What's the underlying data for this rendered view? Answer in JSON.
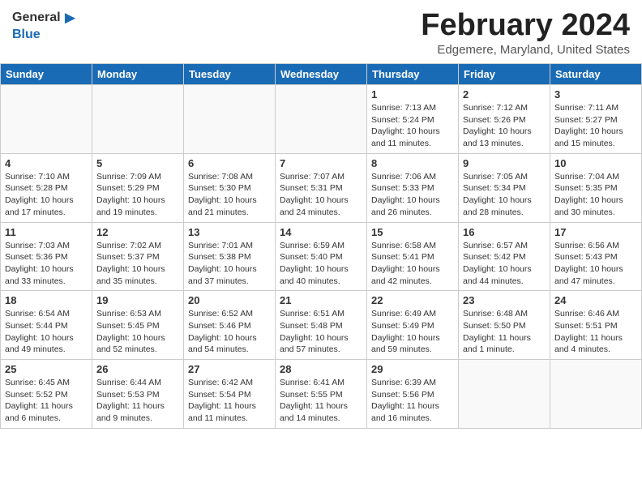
{
  "header": {
    "logo_general": "General",
    "logo_blue": "Blue",
    "month_year": "February 2024",
    "location": "Edgemere, Maryland, United States"
  },
  "days_of_week": [
    "Sunday",
    "Monday",
    "Tuesday",
    "Wednesday",
    "Thursday",
    "Friday",
    "Saturday"
  ],
  "weeks": [
    [
      {
        "day": "",
        "info": ""
      },
      {
        "day": "",
        "info": ""
      },
      {
        "day": "",
        "info": ""
      },
      {
        "day": "",
        "info": ""
      },
      {
        "day": "1",
        "info": "Sunrise: 7:13 AM\nSunset: 5:24 PM\nDaylight: 10 hours\nand 11 minutes."
      },
      {
        "day": "2",
        "info": "Sunrise: 7:12 AM\nSunset: 5:26 PM\nDaylight: 10 hours\nand 13 minutes."
      },
      {
        "day": "3",
        "info": "Sunrise: 7:11 AM\nSunset: 5:27 PM\nDaylight: 10 hours\nand 15 minutes."
      }
    ],
    [
      {
        "day": "4",
        "info": "Sunrise: 7:10 AM\nSunset: 5:28 PM\nDaylight: 10 hours\nand 17 minutes."
      },
      {
        "day": "5",
        "info": "Sunrise: 7:09 AM\nSunset: 5:29 PM\nDaylight: 10 hours\nand 19 minutes."
      },
      {
        "day": "6",
        "info": "Sunrise: 7:08 AM\nSunset: 5:30 PM\nDaylight: 10 hours\nand 21 minutes."
      },
      {
        "day": "7",
        "info": "Sunrise: 7:07 AM\nSunset: 5:31 PM\nDaylight: 10 hours\nand 24 minutes."
      },
      {
        "day": "8",
        "info": "Sunrise: 7:06 AM\nSunset: 5:33 PM\nDaylight: 10 hours\nand 26 minutes."
      },
      {
        "day": "9",
        "info": "Sunrise: 7:05 AM\nSunset: 5:34 PM\nDaylight: 10 hours\nand 28 minutes."
      },
      {
        "day": "10",
        "info": "Sunrise: 7:04 AM\nSunset: 5:35 PM\nDaylight: 10 hours\nand 30 minutes."
      }
    ],
    [
      {
        "day": "11",
        "info": "Sunrise: 7:03 AM\nSunset: 5:36 PM\nDaylight: 10 hours\nand 33 minutes."
      },
      {
        "day": "12",
        "info": "Sunrise: 7:02 AM\nSunset: 5:37 PM\nDaylight: 10 hours\nand 35 minutes."
      },
      {
        "day": "13",
        "info": "Sunrise: 7:01 AM\nSunset: 5:38 PM\nDaylight: 10 hours\nand 37 minutes."
      },
      {
        "day": "14",
        "info": "Sunrise: 6:59 AM\nSunset: 5:40 PM\nDaylight: 10 hours\nand 40 minutes."
      },
      {
        "day": "15",
        "info": "Sunrise: 6:58 AM\nSunset: 5:41 PM\nDaylight: 10 hours\nand 42 minutes."
      },
      {
        "day": "16",
        "info": "Sunrise: 6:57 AM\nSunset: 5:42 PM\nDaylight: 10 hours\nand 44 minutes."
      },
      {
        "day": "17",
        "info": "Sunrise: 6:56 AM\nSunset: 5:43 PM\nDaylight: 10 hours\nand 47 minutes."
      }
    ],
    [
      {
        "day": "18",
        "info": "Sunrise: 6:54 AM\nSunset: 5:44 PM\nDaylight: 10 hours\nand 49 minutes."
      },
      {
        "day": "19",
        "info": "Sunrise: 6:53 AM\nSunset: 5:45 PM\nDaylight: 10 hours\nand 52 minutes."
      },
      {
        "day": "20",
        "info": "Sunrise: 6:52 AM\nSunset: 5:46 PM\nDaylight: 10 hours\nand 54 minutes."
      },
      {
        "day": "21",
        "info": "Sunrise: 6:51 AM\nSunset: 5:48 PM\nDaylight: 10 hours\nand 57 minutes."
      },
      {
        "day": "22",
        "info": "Sunrise: 6:49 AM\nSunset: 5:49 PM\nDaylight: 10 hours\nand 59 minutes."
      },
      {
        "day": "23",
        "info": "Sunrise: 6:48 AM\nSunset: 5:50 PM\nDaylight: 11 hours\nand 1 minute."
      },
      {
        "day": "24",
        "info": "Sunrise: 6:46 AM\nSunset: 5:51 PM\nDaylight: 11 hours\nand 4 minutes."
      }
    ],
    [
      {
        "day": "25",
        "info": "Sunrise: 6:45 AM\nSunset: 5:52 PM\nDaylight: 11 hours\nand 6 minutes."
      },
      {
        "day": "26",
        "info": "Sunrise: 6:44 AM\nSunset: 5:53 PM\nDaylight: 11 hours\nand 9 minutes."
      },
      {
        "day": "27",
        "info": "Sunrise: 6:42 AM\nSunset: 5:54 PM\nDaylight: 11 hours\nand 11 minutes."
      },
      {
        "day": "28",
        "info": "Sunrise: 6:41 AM\nSunset: 5:55 PM\nDaylight: 11 hours\nand 14 minutes."
      },
      {
        "day": "29",
        "info": "Sunrise: 6:39 AM\nSunset: 5:56 PM\nDaylight: 11 hours\nand 16 minutes."
      },
      {
        "day": "",
        "info": ""
      },
      {
        "day": "",
        "info": ""
      }
    ]
  ]
}
